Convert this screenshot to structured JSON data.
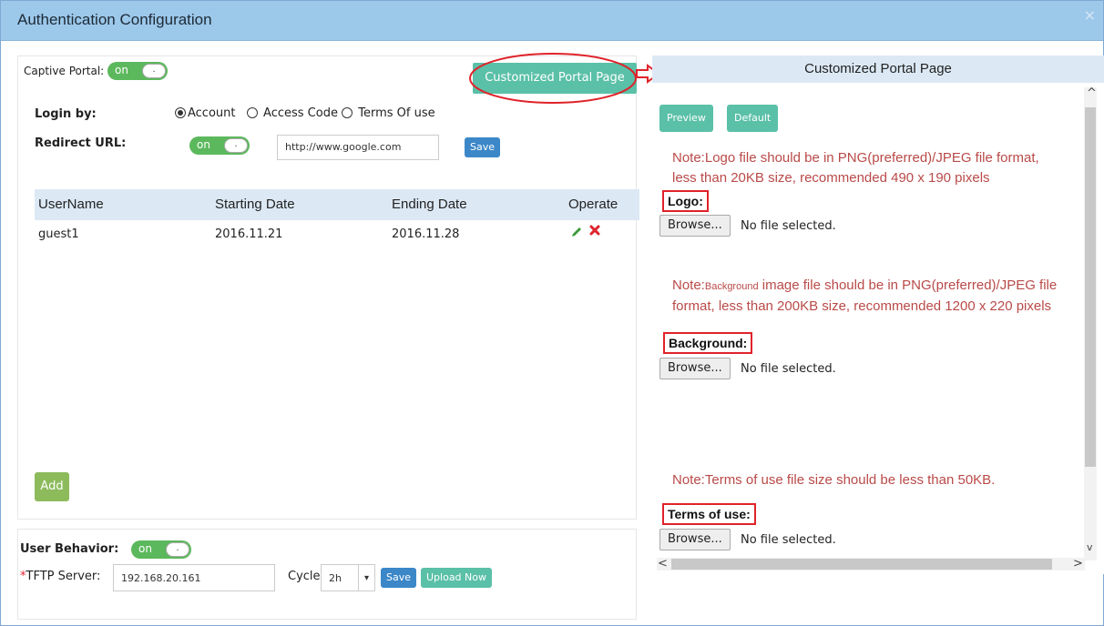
{
  "window": {
    "title": "Authentication Configuration",
    "close": "×"
  },
  "captive": {
    "label": "Captive Portal:",
    "toggle_on": "on",
    "toggle_knob": "."
  },
  "customize_button": "Customized Portal Page",
  "login": {
    "label": "Login by:",
    "options": [
      "Account",
      "Access Code",
      "Terms Of use"
    ],
    "selected": "Account"
  },
  "redirect": {
    "label": "Redirect URL:",
    "toggle_on": "on",
    "toggle_knob": ".",
    "url": "http://www.google.com",
    "save": "Save"
  },
  "table": {
    "headers": [
      "UserName",
      "Starting Date",
      "Ending Date",
      "Operate"
    ],
    "rows": [
      {
        "username": "guest1",
        "start": "2016.11.21",
        "end": "2016.11.28"
      }
    ]
  },
  "add_button": "Add",
  "behavior": {
    "label": "User Behavior:",
    "toggle_on": "on",
    "toggle_knob": ".",
    "tftp_label": "TFTP Server:",
    "required_mark": "*",
    "tftp_value": "192.168.20.161",
    "cycle_label": "Cycle:",
    "cycle_value": "2h",
    "save": "Save",
    "upload": "Upload Now"
  },
  "right": {
    "header": "Customized Portal Page",
    "preview": "Preview",
    "default": "Default",
    "logo_note_line1": "Note:Logo file should be in PNG(preferred)/JPEG file format,",
    "logo_note_line2": "less than 20KB size, recommended 490 x 190 pixels",
    "logo_label": "Logo:",
    "bg_note_prefix": "Note:",
    "bg_note_small": "Background",
    "bg_note_line1_rest": " image file should be in PNG(preferred)/JPEG file",
    "bg_note_line2": "format, less than 200KB size, recommended 1200 x 220 pixels",
    "bg_label": "Background:",
    "terms_note": "Note:Terms of use file size should be less than 50KB.",
    "terms_label": "Terms of use:",
    "browse": "Browse...",
    "no_file": "No file selected."
  },
  "colors": {
    "accent_red": "#e0222a",
    "note_red": "#b94a48",
    "header_blue": "#9cc8ea"
  }
}
